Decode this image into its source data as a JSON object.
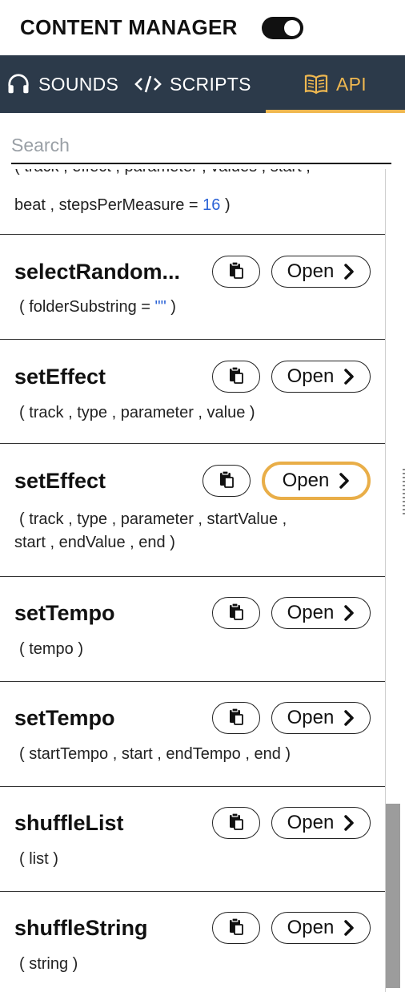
{
  "header": {
    "title": "CONTENT MANAGER",
    "toggle_on": true
  },
  "tabs": [
    {
      "label": "SOUNDS",
      "icon": "headphones-icon",
      "active": false
    },
    {
      "label": "SCRIPTS",
      "icon": "code-icon",
      "active": false
    },
    {
      "label": "API",
      "icon": "book-icon",
      "active": true
    }
  ],
  "colors": {
    "tab_bar": "#2c3a4a",
    "active_accent": "#f0b850",
    "focus_ring": "#e9ae48",
    "literal": "#2a62d6"
  },
  "search": {
    "placeholder": "Search",
    "value": ""
  },
  "top_fragment": {
    "cut_line": "( track , effect , parameter , values , start ,",
    "line_prefix": "beat , stepsPerMeasure = ",
    "line_number": "16",
    "line_suffix": " )"
  },
  "items": [
    {
      "name": "selectRandom...",
      "params_prefix": "( folderSubstring = ",
      "params_literal": "\"\"",
      "params_suffix": " )",
      "open_label": "Open"
    },
    {
      "name": "setEffect",
      "params": "( track , type , parameter , value )",
      "open_label": "Open"
    },
    {
      "name": "setEffect",
      "params_line1": "( track , type , parameter , startValue ,",
      "params_line2": "start , endValue , end )",
      "open_label": "Open",
      "focused": true
    },
    {
      "name": "setTempo",
      "params": "( tempo )",
      "open_label": "Open"
    },
    {
      "name": "setTempo",
      "params": "( startTempo , start , endTempo , end )",
      "open_label": "Open"
    },
    {
      "name": "shuffleList",
      "params": "( list )",
      "open_label": "Open"
    },
    {
      "name": "shuffleString",
      "params": "( string )",
      "open_label": "Open"
    }
  ]
}
